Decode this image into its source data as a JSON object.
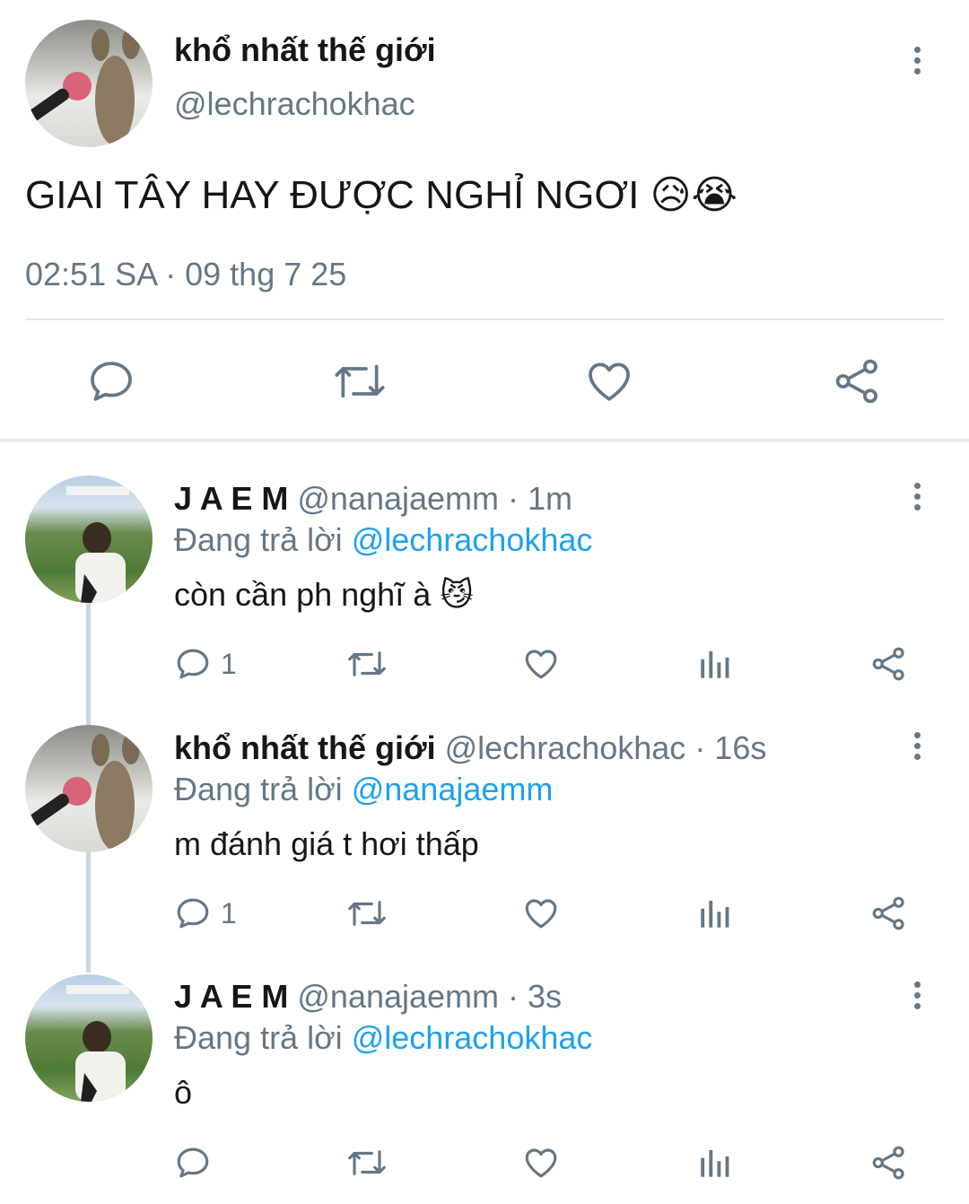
{
  "main_tweet": {
    "display_name": "khổ nhất thế giới",
    "handle": "@lechrachokhac",
    "text": "GIAI TÂY HAY ĐƯỢC NGHỈ NGƠI",
    "emoji": "😥😭",
    "timestamp": "02:51 SA · 09 thg 7 25"
  },
  "replies": [
    {
      "display_name": "J A E M",
      "handle": "@nanajaemm",
      "time": "· 1m",
      "replying_prefix": "Đang trả lời",
      "replying_to": "@lechrachokhac",
      "text": "còn cần ph nghĩ à",
      "emoji": "😼",
      "reply_count": "1"
    },
    {
      "display_name": "khổ nhất thế giới",
      "handle": "@lechrachokhac",
      "time": "· 16s",
      "replying_prefix": "Đang trả lời",
      "replying_to": "@nanajaemm",
      "text": "m đánh giá t hơi thấp",
      "emoji": "",
      "reply_count": "1"
    },
    {
      "display_name": "J A E M",
      "handle": "@nanajaemm",
      "time": "· 3s",
      "replying_prefix": "Đang trả lời",
      "replying_to": "@lechrachokhac",
      "text": "ô",
      "emoji": "",
      "reply_count": ""
    }
  ],
  "colors": {
    "icon_gray": "#657786",
    "link_blue": "#1da1f2",
    "divider": "#e1e8ed"
  },
  "icons": [
    "comment-icon",
    "retweet-icon",
    "like-icon",
    "share-icon",
    "analytics-icon",
    "more-options-icon"
  ]
}
